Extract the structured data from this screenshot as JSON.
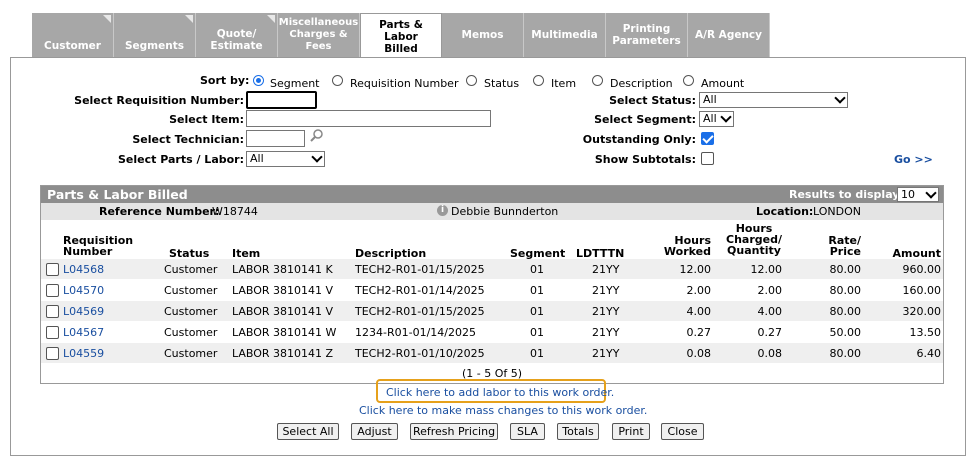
{
  "tabs": [
    {
      "label": "Customer"
    },
    {
      "label": "Segments"
    },
    {
      "label": "Quote/\nEstimate"
    },
    {
      "label": "Miscellaneous\nCharges & Fees"
    },
    {
      "label": "Parts & Labor\nBilled"
    },
    {
      "label": "Memos"
    },
    {
      "label": "Multimedia"
    },
    {
      "label": "Printing\nParameters"
    },
    {
      "label": "A/R Agency"
    }
  ],
  "filters": {
    "sort_by_label": "Sort by:",
    "sort_options": [
      "Segment",
      "Requisition Number",
      "Status",
      "Item",
      "Description",
      "Amount"
    ],
    "req_label": "Select Requisition Number:",
    "req_value": "",
    "item_label": "Select Item:",
    "item_value": "",
    "tech_label": "Select Technician:",
    "tech_value": "",
    "parts_label": "Select Parts / Labor:",
    "parts_value": "All",
    "status_label": "Select Status:",
    "status_value": "All",
    "segment_label": "Select Segment:",
    "segment_value": "All",
    "outstanding_label": "Outstanding Only:",
    "subtotals_label": "Show Subtotals:",
    "go_label": "Go >>"
  },
  "grid": {
    "title": "Parts & Labor Billed",
    "results_label": "Results to display:",
    "results_value": "10",
    "ref_label": "Reference Number:",
    "ref_value": "W18744",
    "user": "Debbie Bunnderton",
    "location_label": "Location:",
    "location_value": "LONDON",
    "columns": {
      "req": "Requisition\nNumber",
      "status": "Status",
      "item": "Item",
      "desc": "Description",
      "segment": "Segment",
      "ldt": "LDTTTN",
      "hours": "Hours\nWorked",
      "charged": "Hours\nCharged/\nQuantity",
      "rate": "Rate/\nPrice",
      "amount": "Amount"
    },
    "rows": [
      {
        "req": "L04568",
        "status": "Customer",
        "item": "LABOR 3810141 K",
        "desc": "TECH2-R01-01/15/2025",
        "segment": "01",
        "ldt": "21YY",
        "hours": "12.00",
        "charged": "12.00",
        "rate": "80.00",
        "amount": "960.00"
      },
      {
        "req": "L04570",
        "status": "Customer",
        "item": "LABOR 3810141 V",
        "desc": "TECH2-R01-01/14/2025",
        "segment": "01",
        "ldt": "21YY",
        "hours": "2.00",
        "charged": "2.00",
        "rate": "80.00",
        "amount": "160.00"
      },
      {
        "req": "L04569",
        "status": "Customer",
        "item": "LABOR 3810141 V",
        "desc": "TECH2-R01-01/15/2025",
        "segment": "01",
        "ldt": "21YY",
        "hours": "4.00",
        "charged": "4.00",
        "rate": "80.00",
        "amount": "320.00"
      },
      {
        "req": "L04567",
        "status": "Customer",
        "item": "LABOR 3810141 W",
        "desc": "1234-R01-01/14/2025",
        "segment": "01",
        "ldt": "21YY",
        "hours": "0.27",
        "charged": "0.27",
        "rate": "50.00",
        "amount": "13.50"
      },
      {
        "req": "L04559",
        "status": "Customer",
        "item": "LABOR 3810141 Z",
        "desc": "TECH2-R01-01/10/2025",
        "segment": "01",
        "ldt": "21YY",
        "hours": "0.08",
        "charged": "0.08",
        "rate": "80.00",
        "amount": "6.40"
      }
    ],
    "pager": "(1 - 5 Of 5)"
  },
  "links": {
    "add_labor": "Click here to add labor to this work order.",
    "mass_change": "Click here to make mass changes to this work order."
  },
  "buttons": [
    "Select All",
    "Adjust",
    "Refresh Pricing",
    "SLA",
    "Totals",
    "Print",
    "Close"
  ]
}
